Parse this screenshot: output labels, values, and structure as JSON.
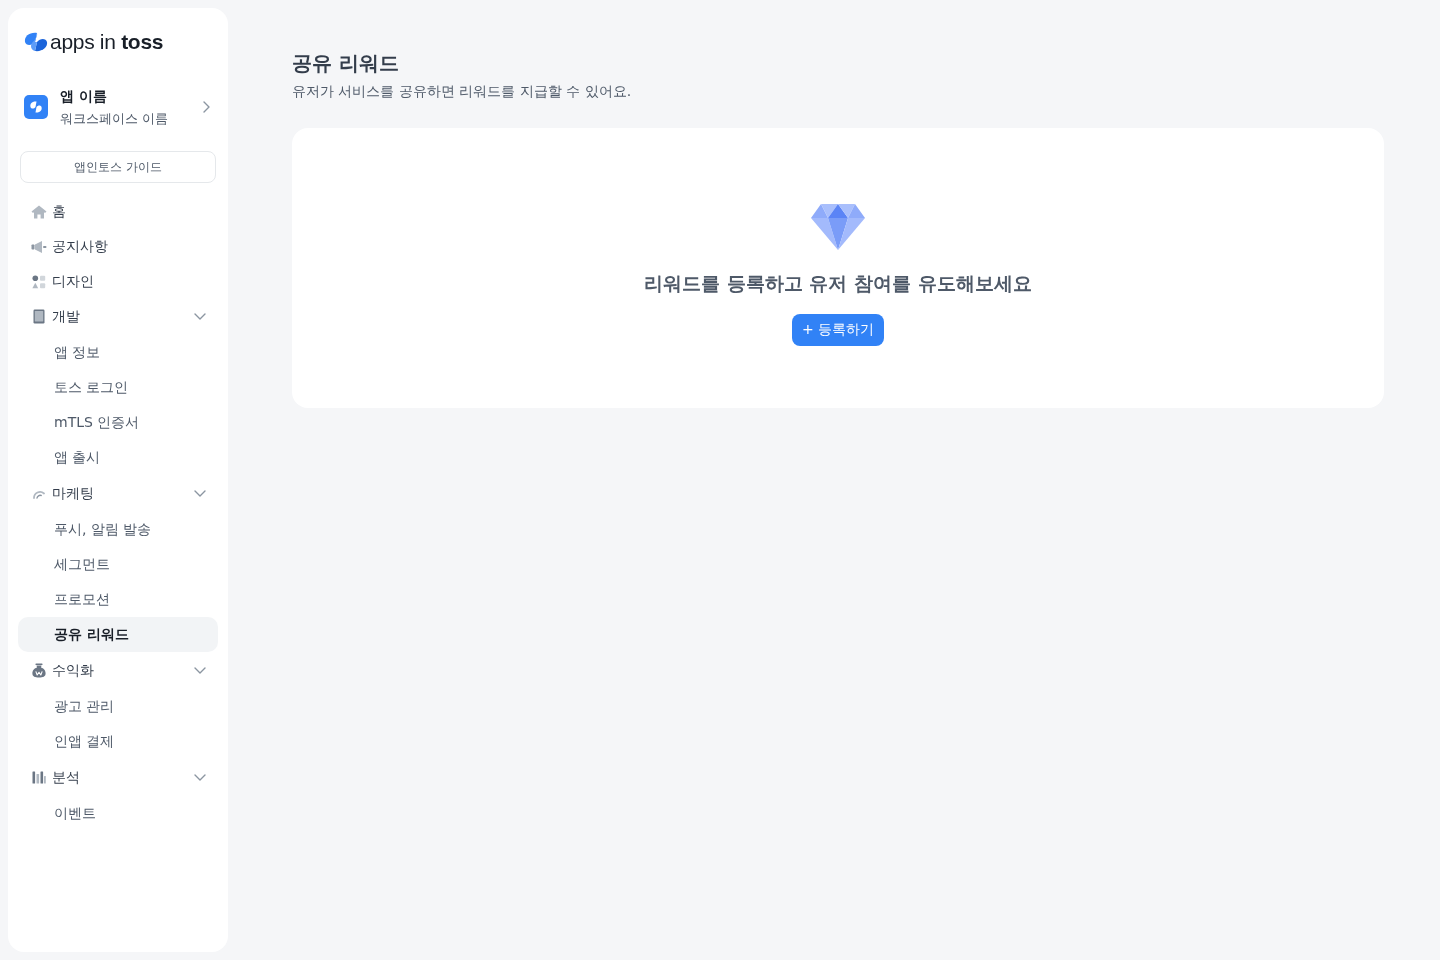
{
  "sidebar": {
    "logo": "apps in **toss**",
    "app": {
      "name": "앱 이름",
      "workspace": "워크스페이스 이름"
    },
    "guide_button": "앱인토스 가이드",
    "nav": [
      {
        "label": "홈",
        "selected": false
      },
      {
        "label": "공지사항",
        "selected": false
      },
      {
        "label": "디자인",
        "selected": false
      },
      {
        "label": "개발",
        "selected": false,
        "expanded": true,
        "children": [
          {
            "label": "앱 정보",
            "selected": false
          },
          {
            "label": "토스 로그인",
            "selected": false
          },
          {
            "label": "mTLS 인증서",
            "selected": false
          },
          {
            "label": "앱 출시",
            "selected": false
          }
        ]
      },
      {
        "label": "마케팅",
        "selected": false,
        "expanded": true,
        "children": [
          {
            "label": "푸시, 알림 발송",
            "selected": false
          },
          {
            "label": "세그먼트",
            "selected": false
          },
          {
            "label": "프로모션",
            "selected": false
          },
          {
            "label": "공유 리워드",
            "selected": true
          }
        ]
      },
      {
        "label": "수익화",
        "selected": false,
        "expanded": true,
        "children": [
          {
            "label": "광고 관리",
            "selected": false
          },
          {
            "label": "인앱 결제",
            "selected": false
          }
        ]
      },
      {
        "label": "분석",
        "selected": false,
        "expanded": true,
        "children": [
          {
            "label": "이벤트",
            "selected": false
          }
        ]
      }
    ]
  },
  "page": {
    "title": "공유 리워드",
    "description": "유저가 서비스를 공유하면 리워드를 지급할 수 있어요.",
    "empty_state": {
      "message": "리워드를 등록하고 유저 참여를 유도해보세요",
      "button": "+ 등록하기"
    }
  }
}
